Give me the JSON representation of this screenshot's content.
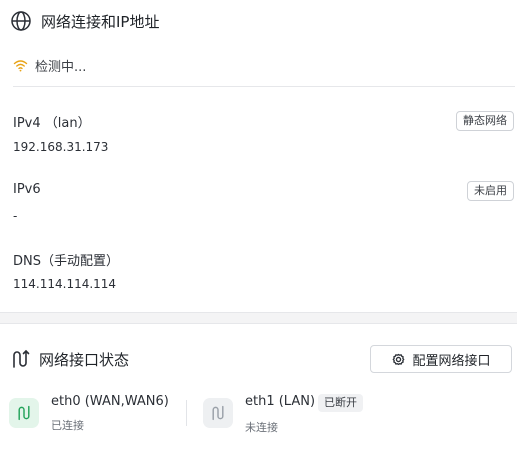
{
  "section_network": {
    "title": "网络连接和IP地址",
    "icon": "globe-icon",
    "detecting": "检测中...",
    "detect_icon": "wifi-icon",
    "ipv4": {
      "label": "IPv4 （lan）",
      "value": "192.168.31.173",
      "badge": "静态网络"
    },
    "ipv6": {
      "label": "IPv6",
      "value": "-",
      "badge": "未启用"
    },
    "dns": {
      "label": "DNS（手动配置）",
      "value": "114.114.114.114"
    }
  },
  "section_interfaces": {
    "title": "网络接口状态",
    "icon": "route-icon",
    "config_button": "配置网络接口",
    "config_icon": "gear-icon",
    "interfaces": [
      {
        "name": "eth0 (WAN,WAN6)",
        "status": "已连接",
        "badge": "",
        "color": "#22a35a"
      },
      {
        "name": "eth1 (LAN)",
        "status": "未连接",
        "badge": "已断开",
        "color": "#9aa0a8"
      }
    ]
  },
  "colors": {
    "connected": "#22a35a",
    "detect": "#e8a317"
  }
}
